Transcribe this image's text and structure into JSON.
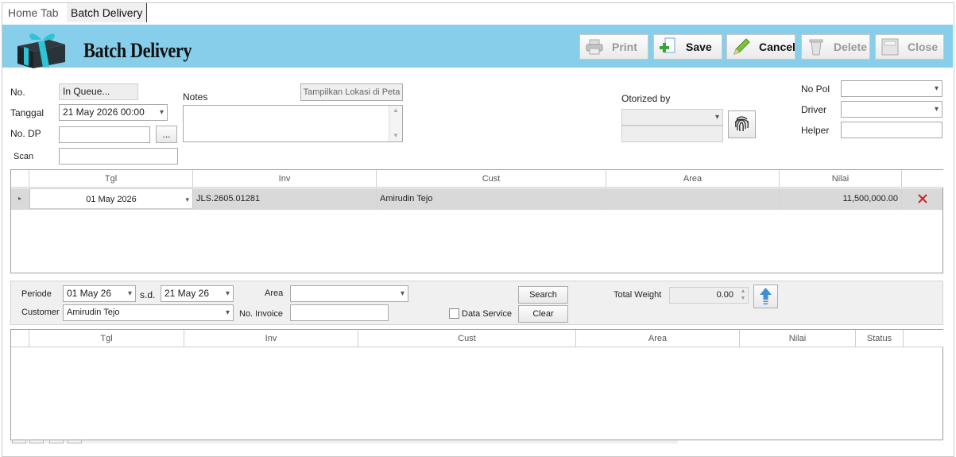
{
  "tabs": [
    {
      "label": "Home Tab"
    },
    {
      "label": "Batch Delivery"
    }
  ],
  "header": {
    "title": "Batch Delivery",
    "logo_icon": "gift-box-icon",
    "buttons": [
      {
        "label": "Print",
        "icon": "printer-icon",
        "enabled": false
      },
      {
        "label": "Save",
        "icon": "save-plus-icon",
        "enabled": true
      },
      {
        "label": "Cancel",
        "icon": "pencil-icon",
        "enabled": true
      },
      {
        "label": "Delete",
        "icon": "trash-icon",
        "enabled": false
      },
      {
        "label": "Close",
        "icon": "exit-icon",
        "enabled": false
      }
    ]
  },
  "form": {
    "no_label": "No.",
    "no_value": "In Queue...",
    "tanggal_label": "Tanggal",
    "tanggal_value": "21 May 2026 00:00",
    "nodp_label": "No. DP",
    "nodp_value": "",
    "nodp_button": "...",
    "scan_label": "Scan",
    "scan_value": "",
    "notes_label": "Notes",
    "notes_value": "",
    "map_button": "Tampilkan Lokasi di Peta",
    "otorized_label": "Otorized by",
    "otorized_value": "",
    "otorized_detail": "",
    "fingerprint_icon": "fingerprint-icon",
    "nopol_label": "No Pol",
    "nopol_value": "",
    "driver_label": "Driver",
    "driver_value": "",
    "helper_label": "Helper",
    "helper_value": ""
  },
  "detail_grid": {
    "columns": [
      "Tgl",
      "Inv",
      "Cust",
      "Area",
      "Nilai"
    ],
    "rows": [
      {
        "tgl": "01 May 2026",
        "inv": "JLS.2605.01281",
        "cust": "Amirudin Tejo",
        "area": "",
        "nilai": "11,500,000.00",
        "delete_icon": "delete-x-icon"
      }
    ]
  },
  "filter": {
    "periode_label": "Periode",
    "periode_from": "01 May 26",
    "sd_label": "s.d.",
    "periode_to": "21 May 26",
    "area_label": "Area",
    "area_value": "",
    "customer_label": "Customer",
    "customer_value": "Amirudin Tejo",
    "invoice_label": "No. Invoice",
    "invoice_value": "",
    "search_button": "Search",
    "clear_button": "Clear",
    "data_service_label": "Data Service",
    "data_service_checked": false,
    "total_weight_label": "Total Weight",
    "total_weight_value": "0.00",
    "upload_icon": "upload-arrow-icon"
  },
  "result_grid": {
    "columns": [
      "Tgl",
      "Inv",
      "Cust",
      "Area",
      "Nilai",
      "Status"
    ],
    "rows": []
  },
  "colors": {
    "header_bg": "#87ceeb",
    "delete_x": "#cc2222"
  }
}
